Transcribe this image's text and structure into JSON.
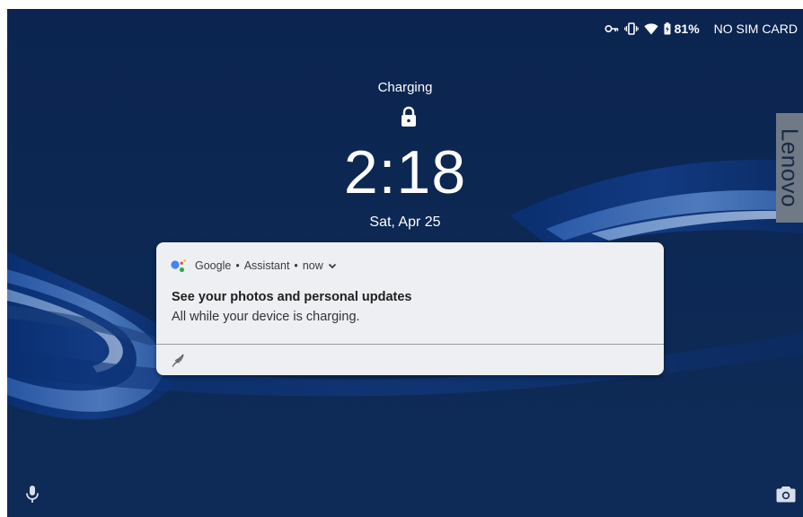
{
  "status_bar": {
    "battery_percent": "81%",
    "sim_status": "NO SIM CARD",
    "icons": [
      "vpn-key-icon",
      "vibrate-icon",
      "wifi-icon",
      "battery-charging-icon"
    ]
  },
  "lockscreen": {
    "charging_label": "Charging",
    "time": "2:18",
    "date": "Sat, Apr 25",
    "lock_icon": "lock-icon"
  },
  "brand": {
    "text": "Lenovo"
  },
  "notification": {
    "app_name": "Google",
    "sub_text": "Assistant",
    "time": "now",
    "separator": "•",
    "title": "See your photos and personal updates",
    "body": "All while your device is charging.",
    "icons": [
      "google-assistant-icon",
      "chevron-down-icon",
      "snooze-feather-icon"
    ]
  },
  "shortcuts": {
    "left": "mic-icon",
    "right": "camera-icon"
  },
  "colors": {
    "background": "#0d2a55",
    "notification_bg": "#eeeff2",
    "assistant_blue": "#4285f4",
    "assistant_red": "#ea4335",
    "assistant_yellow": "#fbbc05",
    "assistant_green": "#34a853"
  }
}
